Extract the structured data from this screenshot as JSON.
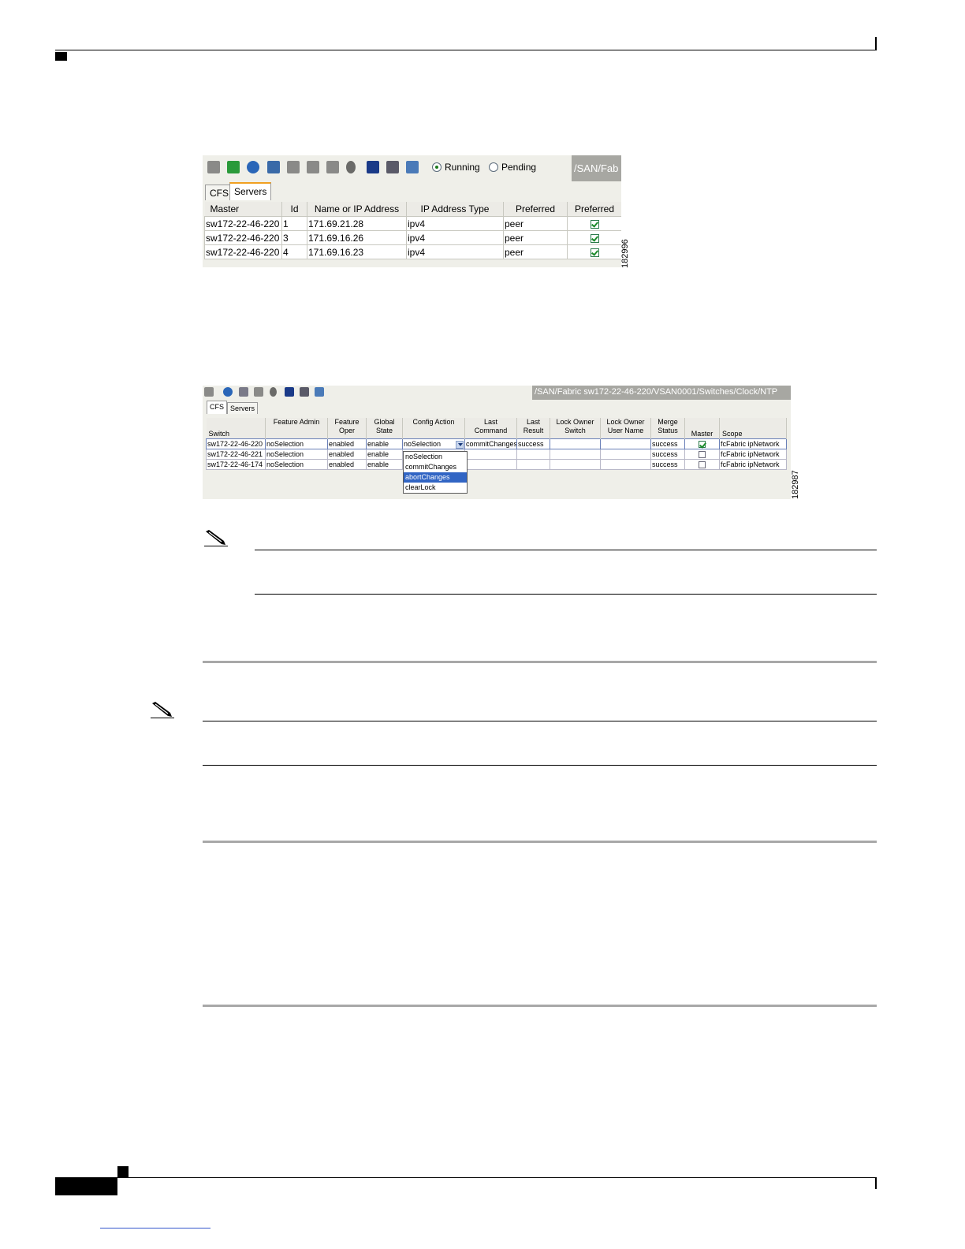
{
  "figure1": {
    "radio_running": "Running",
    "radio_pending": "Pending",
    "path": "/SAN/Fab",
    "tabs": [
      "CFS",
      "Servers"
    ],
    "columns": [
      "Master",
      "Id",
      "Name or IP Address",
      "IP Address Type",
      "Preferred",
      "Preferred"
    ],
    "rows": [
      {
        "master": "sw172-22-46-220",
        "id": "1",
        "ip": "171.69.21.28",
        "type": "ipv4",
        "pref": "peer",
        "checked": true
      },
      {
        "master": "sw172-22-46-220",
        "id": "3",
        "ip": "171.69.16.26",
        "type": "ipv4",
        "pref": "peer",
        "checked": true
      },
      {
        "master": "sw172-22-46-220",
        "id": "4",
        "ip": "171.69.16.23",
        "type": "ipv4",
        "pref": "peer",
        "checked": true
      }
    ],
    "figure_number": "182996"
  },
  "figure2": {
    "path": "/SAN/Fabric sw172-22-46-220/VSAN0001/Switches/Clock/NTP",
    "tabs": [
      "CFS",
      "Servers"
    ],
    "columns": [
      "Switch",
      "Feature Admin",
      "Feature Oper",
      "Global State",
      "Config Action",
      "Last Command",
      "Last Result",
      "Lock Owner Switch",
      "Lock Owner User Name",
      "Merge Status",
      "Master",
      "Scope"
    ],
    "rows": [
      {
        "switch": "sw172-22-46-220",
        "admin": "noSelection",
        "oper": "enabled",
        "state": "enable",
        "action": "noSelection",
        "cmd": "commitChanges",
        "result": "success",
        "merge": "success",
        "master": true,
        "scope": "fcFabric ipNetwork"
      },
      {
        "switch": "sw172-22-46-221",
        "admin": "noSelection",
        "oper": "enabled",
        "state": "enable",
        "action": "",
        "cmd": "",
        "result": "",
        "merge": "success",
        "master": false,
        "scope": "fcFabric ipNetwork"
      },
      {
        "switch": "sw172-22-46-174",
        "admin": "noSelection",
        "oper": "enabled",
        "state": "enable",
        "action": "",
        "cmd": "",
        "result": "",
        "merge": "success",
        "master": false,
        "scope": "fcFabric ipNetwork"
      }
    ],
    "dropdown_options": [
      "noSelection",
      "commitChanges",
      "abortChanges",
      "clearLock"
    ],
    "dropdown_highlighted": "abortChanges",
    "figure_number": "182987"
  }
}
